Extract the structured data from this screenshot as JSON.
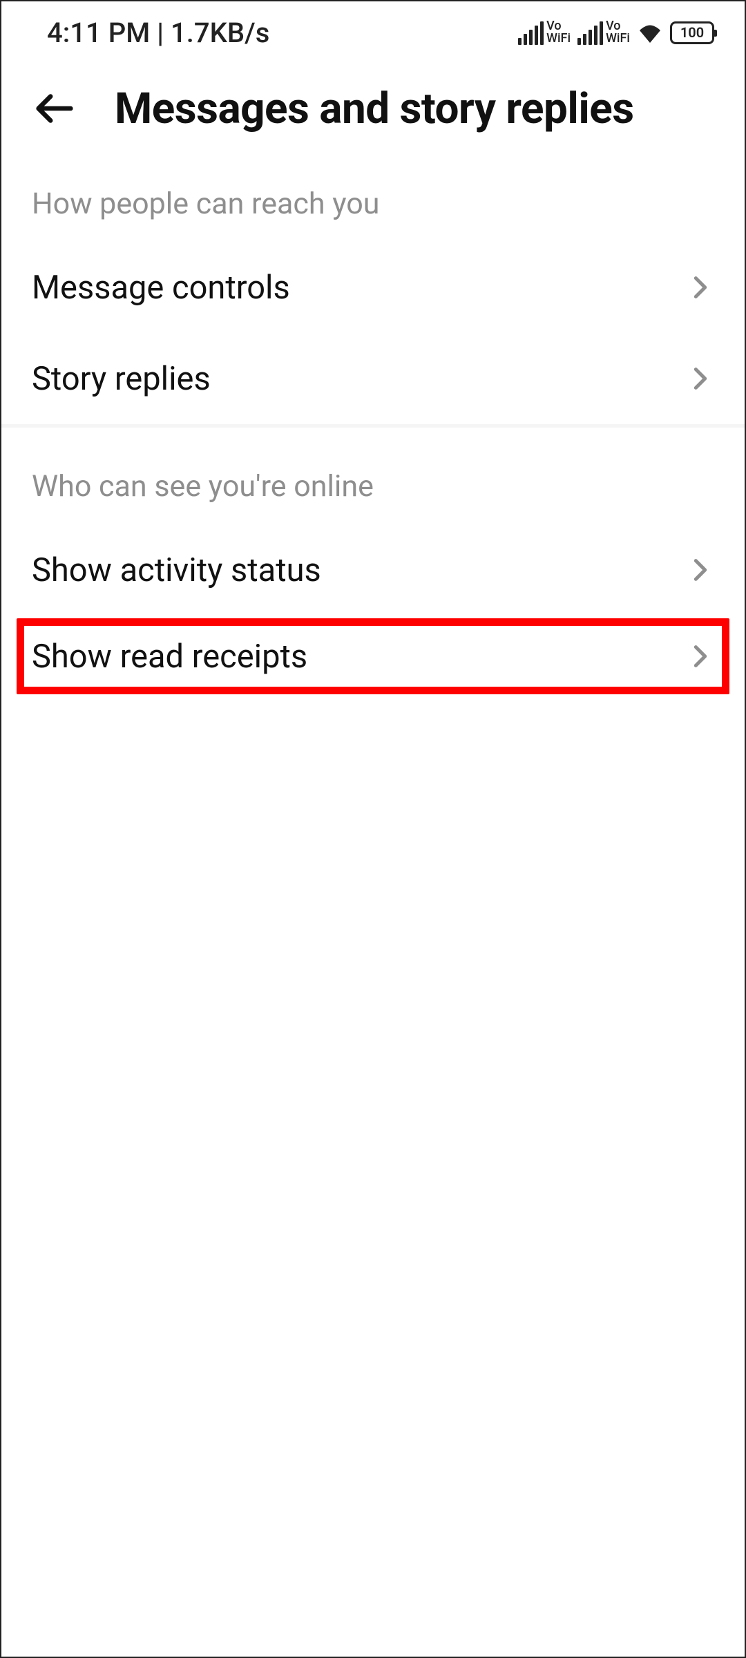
{
  "status_bar": {
    "time_and_data": "4:11 PM | 1.7KB/s",
    "vowifi_label": "Vo\nWiFi",
    "battery_level": "100"
  },
  "header": {
    "title": "Messages and story replies"
  },
  "sections": {
    "reach": {
      "title": "How people can reach you",
      "items": [
        {
          "label": "Message controls"
        },
        {
          "label": "Story replies"
        }
      ]
    },
    "online": {
      "title": "Who can see you're online",
      "items": [
        {
          "label": "Show activity status"
        },
        {
          "label": "Show read receipts"
        }
      ]
    }
  }
}
